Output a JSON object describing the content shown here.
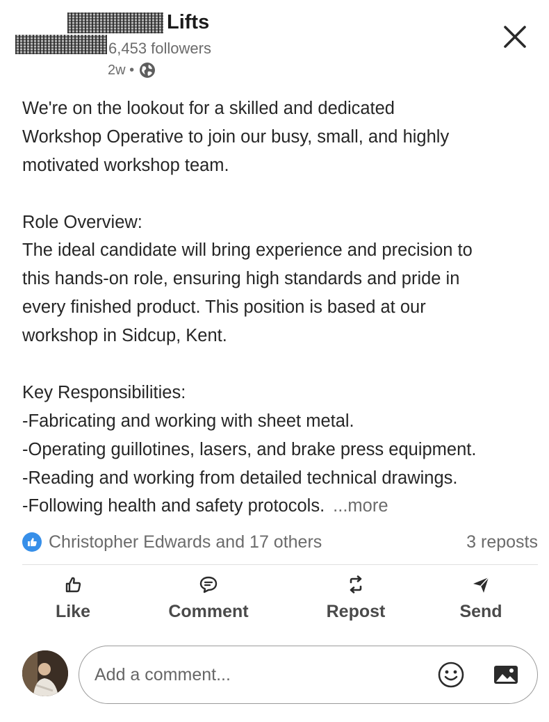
{
  "post": {
    "company_name": "Lifts",
    "followers": "6,453 followers",
    "age": "2w •",
    "visibility_icon": "globe-icon",
    "body_lines": [
      "We're on the lookout for a skilled and dedicated",
      "Workshop Operative to join our busy, small, and highly",
      "motivated workshop team.",
      "",
      "Role Overview:",
      "The ideal candidate will bring experience and precision to",
      "this hands-on role, ensuring high standards and pride in",
      "every finished product. This position is based at our",
      "workshop in Sidcup, Kent.",
      "",
      "Key Responsibilities:",
      "-Fabricating and working with sheet metal.",
      "-Operating guillotines, lasers, and brake press equipment.",
      "-Reading and working from detailed technical drawings.",
      "-Following health and safety protocols."
    ],
    "more_label": "...more"
  },
  "social": {
    "reactions_label": "Christopher Edwards and 17 others",
    "reposts_label": "3 reposts",
    "like_badge_color": "#378fe9"
  },
  "actions": {
    "like": "Like",
    "comment": "Comment",
    "repost": "Repost",
    "send": "Send"
  },
  "comment": {
    "placeholder": "Add a comment..."
  }
}
